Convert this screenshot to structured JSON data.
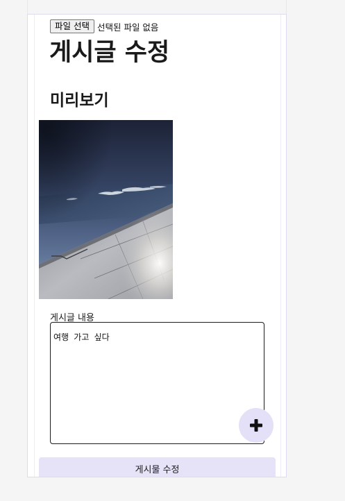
{
  "file_input": {
    "button_label": "파일 선택",
    "status_text": "선택된 파일 없음"
  },
  "page_title": "게시글 수정",
  "preview": {
    "heading": "미리보기"
  },
  "content": {
    "label": "게시글 내용",
    "value": "여행 가고 싶다"
  },
  "fab": {
    "icon": "plus-icon"
  },
  "submit": {
    "label": "게시물 수정"
  },
  "colors": {
    "accent": "#e6e2f8",
    "fab_bg": "#e3e0f8",
    "page_bg": "#f5f5f5"
  }
}
